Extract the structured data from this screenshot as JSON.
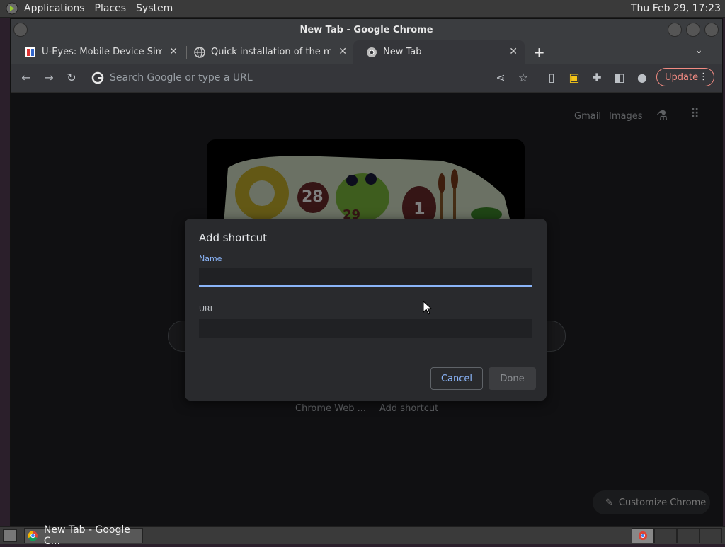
{
  "system_panel": {
    "menus": [
      "Applications",
      "Places",
      "System"
    ],
    "clock": "Thu Feb 29, 17:23"
  },
  "window": {
    "title": "New Tab - Google Chrome"
  },
  "tabs": [
    {
      "title": "U-Eyes: Mobile Device Simula",
      "icon": "u-eyes-favicon",
      "active": false
    },
    {
      "title": "Quick installation of the mobil",
      "icon": "globe-icon",
      "active": false
    },
    {
      "title": "New Tab",
      "icon": "chrome-icon",
      "active": true
    }
  ],
  "toolbar": {
    "omnibox_placeholder": "Search Google or type a URL",
    "update_label": "Update"
  },
  "ntp": {
    "gmail": "Gmail",
    "images": "Images",
    "shortcuts": [
      "Chrome Web ...",
      "Add shortcut"
    ],
    "customize_label": "Customize Chrome",
    "doodle_numbers": [
      "28",
      "29",
      "1"
    ]
  },
  "dialog": {
    "title": "Add shortcut",
    "name_label": "Name",
    "name_value": "",
    "url_label": "URL",
    "url_value": "",
    "cancel_label": "Cancel",
    "done_label": "Done"
  },
  "taskbar": {
    "task_label": "New Tab - Google C..."
  },
  "colors": {
    "accent_blue": "#8ab4f8",
    "update_red": "#f28b82",
    "dialog_bg": "#292a2d",
    "page_bg": "#202124"
  }
}
